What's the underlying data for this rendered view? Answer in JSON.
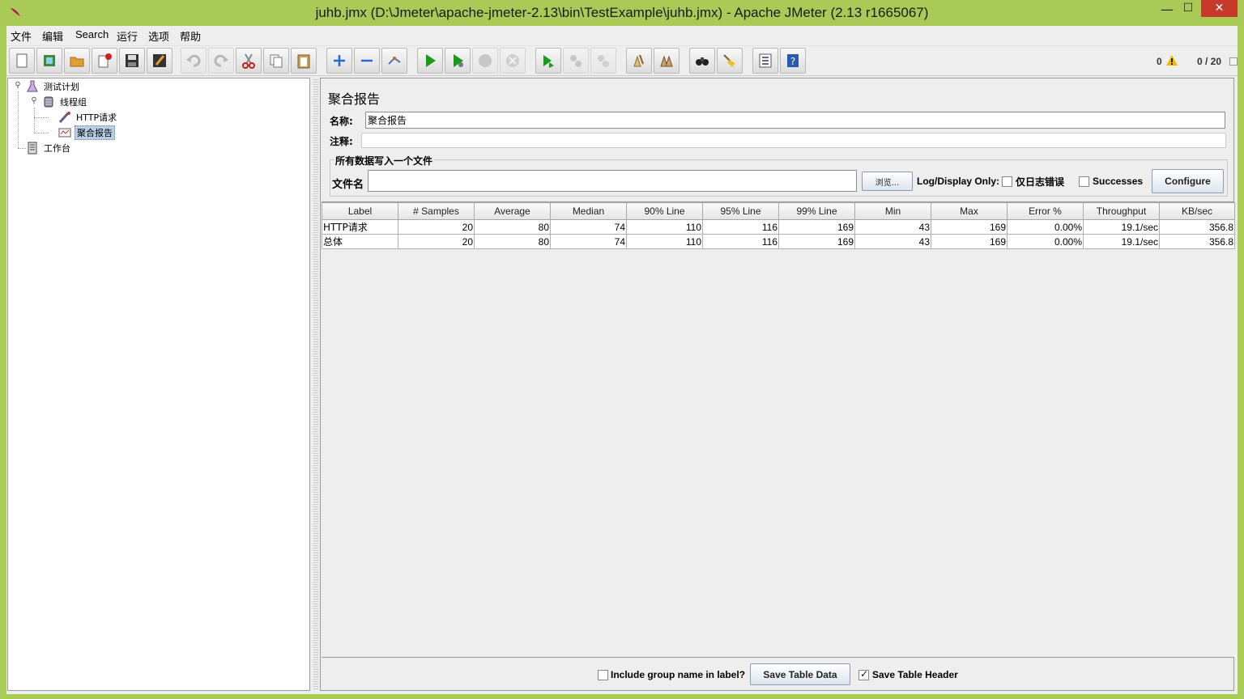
{
  "window": {
    "title": "juhb.jmx (D:\\Jmeter\\apache-jmeter-2.13\\bin\\TestExample\\juhb.jmx) - Apache JMeter (2.13 r1665067)",
    "min_glyph": "—",
    "max_glyph": "☐",
    "close_glyph": "✕"
  },
  "menu": {
    "items": [
      {
        "label": "文件"
      },
      {
        "label": "编辑"
      },
      {
        "label": "Search"
      },
      {
        "label": "运行"
      },
      {
        "label": "选项"
      },
      {
        "label": "帮助"
      }
    ]
  },
  "toolbar": {
    "buttons": [
      {
        "name": "new-icon"
      },
      {
        "name": "templates-icon"
      },
      {
        "name": "open-icon"
      },
      {
        "name": "close-file-icon"
      },
      {
        "name": "save-icon"
      },
      {
        "name": "save-as-icon"
      },
      {
        "name": "undo-icon"
      },
      {
        "name": "redo-icon"
      },
      {
        "name": "cut-icon"
      },
      {
        "name": "copy-icon"
      },
      {
        "name": "paste-icon"
      },
      {
        "name": "expand-icon"
      },
      {
        "name": "collapse-icon"
      },
      {
        "name": "toggle-icon"
      },
      {
        "name": "start-icon"
      },
      {
        "name": "start-no-pause-icon"
      },
      {
        "name": "stop-icon"
      },
      {
        "name": "shutdown-icon"
      },
      {
        "name": "remote-start-icon"
      },
      {
        "name": "remote-stop-icon"
      },
      {
        "name": "remote-shutdown-icon"
      },
      {
        "name": "clear-icon"
      },
      {
        "name": "clear-all-icon"
      },
      {
        "name": "search-icon"
      },
      {
        "name": "reset-search-icon"
      },
      {
        "name": "function-helper-icon"
      },
      {
        "name": "help-icon"
      }
    ],
    "error_count": "0",
    "threads": "0 / 20"
  },
  "tree": {
    "nodes": [
      {
        "label": "测试计划",
        "icon": "test-plan-icon"
      },
      {
        "label": "线程组",
        "icon": "thread-group-icon"
      },
      {
        "label": "HTTP请求",
        "icon": "http-request-icon"
      },
      {
        "label": "聚合报告",
        "icon": "aggregate-report-icon",
        "selected": true
      },
      {
        "label": "工作台",
        "icon": "workbench-icon"
      }
    ]
  },
  "panel": {
    "title": "聚合报告",
    "name_label": "名称:",
    "name_value": "聚合报告",
    "comment_label": "注释:",
    "comment_value": "",
    "file_group_title": "所有数据写入一个文件",
    "filename_label": "文件名",
    "filename_value": "",
    "browse_label": "浏览...",
    "log_display_label": "Log/Display Only:",
    "errors_only_label": "仅日志错误",
    "errors_only_checked": false,
    "successes_label": "Successes",
    "successes_checked": false,
    "configure_label": "Configure"
  },
  "table": {
    "columns": [
      "Label",
      "# Samples",
      "Average",
      "Median",
      "90% Line",
      "95% Line",
      "99% Line",
      "Min",
      "Max",
      "Error %",
      "Throughput",
      "KB/sec"
    ],
    "rows": [
      [
        "HTTP请求",
        "20",
        "80",
        "74",
        "110",
        "116",
        "169",
        "43",
        "169",
        "0.00%",
        "19.1/sec",
        "356.8"
      ],
      [
        "总体",
        "20",
        "80",
        "74",
        "110",
        "116",
        "169",
        "43",
        "169",
        "0.00%",
        "19.1/sec",
        "356.8"
      ]
    ]
  },
  "bottom": {
    "include_group_label": "Include group name in label?",
    "include_group_checked": false,
    "save_table_data_label": "Save Table Data",
    "save_header_label": "Save Table Header",
    "save_header_checked": true
  },
  "colors": {
    "window_frame": "#a9ca57",
    "close_button": "#c7392b",
    "selection": "#b8cfe5"
  }
}
